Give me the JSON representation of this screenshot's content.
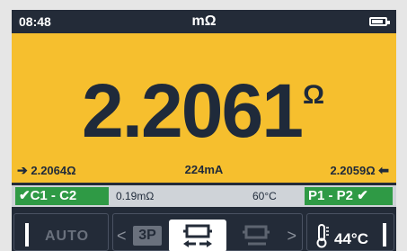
{
  "status": {
    "time": "08:48",
    "unit": "mΩ",
    "battery_level": 0.85
  },
  "reading": {
    "value": "2.2061",
    "unit": "Ω",
    "forward": "2.2064Ω",
    "current": "224mA",
    "reverse": "2.2059Ω"
  },
  "info": {
    "lead_left": "✔C1 - C2",
    "lead_res": "0.19mΩ",
    "temp": "60°C",
    "lead_right": "P1 - P2 ✔"
  },
  "controls": {
    "auto_label": "AUTO",
    "chevron_left": "<",
    "three_phase": "3P",
    "chevron_right": ">",
    "ambient_temp": "44°C"
  },
  "colors": {
    "reading_bg": "#f6bf2e",
    "status_bg": "#232b38",
    "lead_ok": "#2f9a45"
  }
}
